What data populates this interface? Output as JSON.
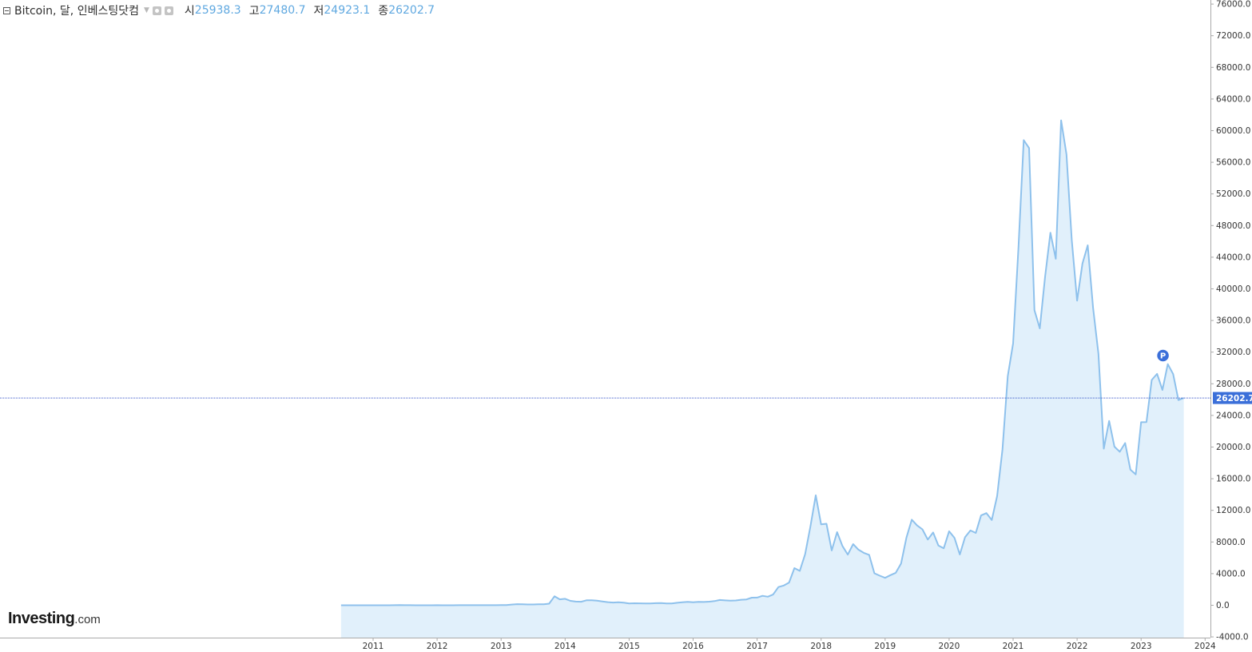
{
  "header": {
    "symbol": "Bitcoin, 달, 인베스팅닷컴",
    "open_label": "시",
    "open_value": "25938.3",
    "high_label": "고",
    "high_value": "27480.7",
    "low_label": "저",
    "low_value": "24923.1",
    "close_label": "종",
    "close_value": "26202.7"
  },
  "logo": {
    "brand": "Investing",
    "tld": ".com"
  },
  "colors": {
    "line": "#8ec1ec",
    "fill": "#e1f0fb",
    "price_line": "#3a58c9",
    "badge": "#3b6fd9",
    "axis": "#aaaaaa"
  },
  "chart_data": {
    "type": "area",
    "title": "Bitcoin, 달, 인베스팅닷컴",
    "interval": "monthly",
    "x_ticks": [
      "2011",
      "2012",
      "2013",
      "2014",
      "2015",
      "2016",
      "2017",
      "2018",
      "2019",
      "2020",
      "2021",
      "2022",
      "2023",
      "2024"
    ],
    "y_ticks": [
      "-4000.0",
      "0.0",
      "4000.0",
      "8000.0",
      "12000.0",
      "16000.0",
      "20000.0",
      "24000.0",
      "28000.0",
      "32000.0",
      "36000.0",
      "40000.0",
      "44000.0",
      "48000.0",
      "52000.0",
      "56000.0",
      "60000.0",
      "64000.0",
      "68000.0",
      "72000.0",
      "76000.0"
    ],
    "ylim": [
      -4000,
      76000
    ],
    "current_price": 26202.7,
    "current_price_label": "26202.7",
    "marker_label": "P",
    "marker_at": "2023-06",
    "points": [
      [
        "2010-07",
        0.07
      ],
      [
        "2010-08",
        0.06
      ],
      [
        "2010-09",
        0.06
      ],
      [
        "2010-10",
        0.2
      ],
      [
        "2010-11",
        0.25
      ],
      [
        "2010-12",
        0.3
      ],
      [
        "2011-01",
        0.9
      ],
      [
        "2011-02",
        0.9
      ],
      [
        "2011-03",
        0.8
      ],
      [
        "2011-04",
        3.5
      ],
      [
        "2011-05",
        9
      ],
      [
        "2011-06",
        16
      ],
      [
        "2011-07",
        13
      ],
      [
        "2011-08",
        8
      ],
      [
        "2011-09",
        5
      ],
      [
        "2011-10",
        3.2
      ],
      [
        "2011-11",
        3
      ],
      [
        "2011-12",
        4.7
      ],
      [
        "2012-01",
        5.5
      ],
      [
        "2012-02",
        4.9
      ],
      [
        "2012-03",
        4.9
      ],
      [
        "2012-04",
        5
      ],
      [
        "2012-05",
        5.1
      ],
      [
        "2012-06",
        6.7
      ],
      [
        "2012-07",
        9
      ],
      [
        "2012-08",
        10
      ],
      [
        "2012-09",
        12.4
      ],
      [
        "2012-10",
        11
      ],
      [
        "2012-11",
        12.5
      ],
      [
        "2012-12",
        13.5
      ],
      [
        "2013-01",
        20
      ],
      [
        "2013-02",
        33
      ],
      [
        "2013-03",
        93
      ],
      [
        "2013-04",
        139
      ],
      [
        "2013-05",
        128
      ],
      [
        "2013-06",
        97
      ],
      [
        "2013-07",
        106
      ],
      [
        "2013-08",
        130
      ],
      [
        "2013-09",
        132
      ],
      [
        "2013-10",
        200
      ],
      [
        "2013-11",
        1130
      ],
      [
        "2013-12",
        750
      ],
      [
        "2014-01",
        820
      ],
      [
        "2014-02",
        560
      ],
      [
        "2014-03",
        460
      ],
      [
        "2014-04",
        440
      ],
      [
        "2014-05",
        630
      ],
      [
        "2014-06",
        640
      ],
      [
        "2014-07",
        580
      ],
      [
        "2014-08",
        480
      ],
      [
        "2014-09",
        390
      ],
      [
        "2014-10",
        340
      ],
      [
        "2014-11",
        380
      ],
      [
        "2014-12",
        320
      ],
      [
        "2015-01",
        220
      ],
      [
        "2015-02",
        250
      ],
      [
        "2015-03",
        245
      ],
      [
        "2015-04",
        235
      ],
      [
        "2015-05",
        230
      ],
      [
        "2015-06",
        260
      ],
      [
        "2015-07",
        285
      ],
      [
        "2015-08",
        230
      ],
      [
        "2015-09",
        235
      ],
      [
        "2015-10",
        315
      ],
      [
        "2015-11",
        377
      ],
      [
        "2015-12",
        430
      ],
      [
        "2016-01",
        370
      ],
      [
        "2016-02",
        435
      ],
      [
        "2016-03",
        415
      ],
      [
        "2016-04",
        450
      ],
      [
        "2016-05",
        530
      ],
      [
        "2016-06",
        670
      ],
      [
        "2016-07",
        620
      ],
      [
        "2016-08",
        575
      ],
      [
        "2016-09",
        610
      ],
      [
        "2016-10",
        700
      ],
      [
        "2016-11",
        740
      ],
      [
        "2016-12",
        960
      ],
      [
        "2017-01",
        970
      ],
      [
        "2017-02",
        1190
      ],
      [
        "2017-03",
        1080
      ],
      [
        "2017-04",
        1350
      ],
      [
        "2017-05",
        2300
      ],
      [
        "2017-06",
        2500
      ],
      [
        "2017-07",
        2870
      ],
      [
        "2017-08",
        4700
      ],
      [
        "2017-09",
        4340
      ],
      [
        "2017-10",
        6450
      ],
      [
        "2017-11",
        9950
      ],
      [
        "2017-12",
        13900
      ],
      [
        "2018-01",
        10220
      ],
      [
        "2018-02",
        10300
      ],
      [
        "2018-03",
        6930
      ],
      [
        "2018-04",
        9240
      ],
      [
        "2018-05",
        7490
      ],
      [
        "2018-06",
        6400
      ],
      [
        "2018-07",
        7730
      ],
      [
        "2018-08",
        7030
      ],
      [
        "2018-09",
        6630
      ],
      [
        "2018-10",
        6370
      ],
      [
        "2018-11",
        4040
      ],
      [
        "2018-12",
        3740
      ],
      [
        "2019-01",
        3460
      ],
      [
        "2019-02",
        3810
      ],
      [
        "2019-03",
        4100
      ],
      [
        "2019-04",
        5280
      ],
      [
        "2019-05",
        8560
      ],
      [
        "2019-06",
        10820
      ],
      [
        "2019-07",
        10090
      ],
      [
        "2019-08",
        9600
      ],
      [
        "2019-09",
        8300
      ],
      [
        "2019-10",
        9200
      ],
      [
        "2019-11",
        7560
      ],
      [
        "2019-12",
        7200
      ],
      [
        "2020-01",
        9350
      ],
      [
        "2020-02",
        8530
      ],
      [
        "2020-03",
        6410
      ],
      [
        "2020-04",
        8620
      ],
      [
        "2020-05",
        9450
      ],
      [
        "2020-06",
        9140
      ],
      [
        "2020-07",
        11350
      ],
      [
        "2020-08",
        11650
      ],
      [
        "2020-09",
        10780
      ],
      [
        "2020-10",
        13800
      ],
      [
        "2020-11",
        19700
      ],
      [
        "2020-12",
        28950
      ],
      [
        "2021-01",
        33100
      ],
      [
        "2021-02",
        45200
      ],
      [
        "2021-03",
        58800
      ],
      [
        "2021-04",
        57800
      ],
      [
        "2021-05",
        37300
      ],
      [
        "2021-06",
        35000
      ],
      [
        "2021-07",
        41500
      ],
      [
        "2021-08",
        47100
      ],
      [
        "2021-09",
        43800
      ],
      [
        "2021-10",
        61300
      ],
      [
        "2021-11",
        57000
      ],
      [
        "2021-12",
        46200
      ],
      [
        "2022-01",
        38500
      ],
      [
        "2022-02",
        43200
      ],
      [
        "2022-03",
        45500
      ],
      [
        "2022-04",
        37600
      ],
      [
        "2022-05",
        31800
      ],
      [
        "2022-06",
        19800
      ],
      [
        "2022-07",
        23300
      ],
      [
        "2022-08",
        20050
      ],
      [
        "2022-09",
        19400
      ],
      [
        "2022-10",
        20500
      ],
      [
        "2022-11",
        17150
      ],
      [
        "2022-12",
        16550
      ],
      [
        "2023-01",
        23140
      ],
      [
        "2023-02",
        23150
      ],
      [
        "2023-03",
        28480
      ],
      [
        "2023-04",
        29250
      ],
      [
        "2023-05",
        27220
      ],
      [
        "2023-06",
        30480
      ],
      [
        "2023-07",
        29230
      ],
      [
        "2023-08",
        25940
      ],
      [
        "2023-09",
        26202.7
      ]
    ]
  }
}
